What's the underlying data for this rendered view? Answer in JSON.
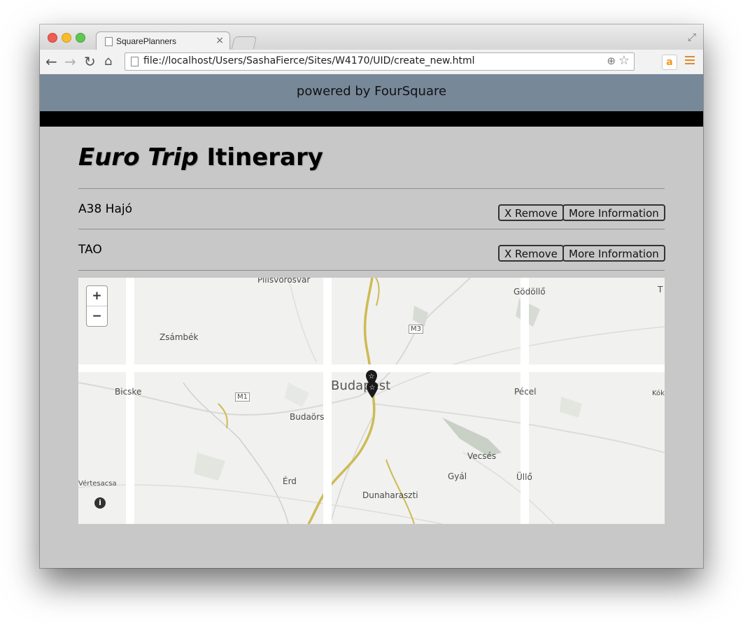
{
  "browser": {
    "tab_title": "SquarePlanners",
    "tab_close": "×",
    "url": "file://localhost/Users/SashaFierce/Sites/W4170/UID/create_new.html",
    "amazon_icon": "a"
  },
  "page": {
    "powered_by": "powered by FourSquare",
    "title_em": "Euro Trip",
    "title_rest": " Itinerary",
    "items": [
      {
        "name": "A38 Hajó",
        "remove_label": "X Remove",
        "info_label": "More Information"
      },
      {
        "name": "TAO",
        "remove_label": "X Remove",
        "info_label": "More Information"
      }
    ]
  },
  "map": {
    "zoom_in": "+",
    "zoom_out": "−",
    "info": "i",
    "labels": {
      "pilisvorosvar": "Pilisvorosvar",
      "godollo": "Gödöllő",
      "t_edge": "T",
      "zsambek": "Zsámbék",
      "m3": "M3",
      "bicske": "Bicske",
      "m1": "M1",
      "budapest": "Budapest",
      "pecel": "Pécel",
      "kok": "Kók",
      "budaors": "Budaörs",
      "vecses": "Vecsés",
      "vertesacsa": "Vértesacsa",
      "erd": "Érd",
      "gyal": "Gyál",
      "ullo": "Üllő",
      "dunaharaszti": "Dunaharaszti"
    }
  }
}
